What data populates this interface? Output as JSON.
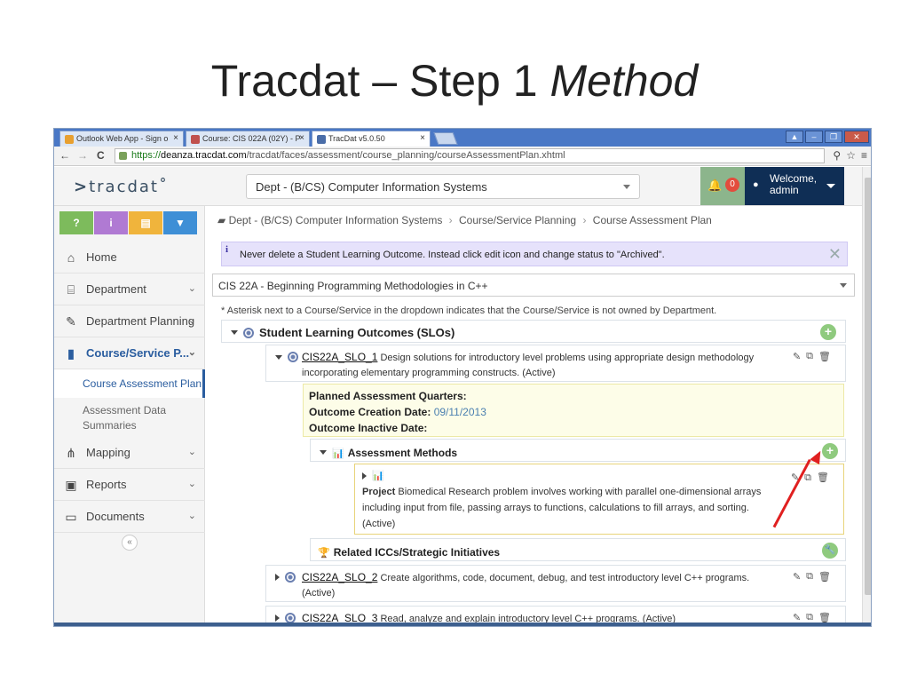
{
  "slide": {
    "title_plain": "Tracdat – Step 1 ",
    "title_italic": "Method"
  },
  "browser": {
    "tabs": [
      {
        "label": "Outlook Web App - Sign o",
        "color": "#e8a030"
      },
      {
        "label": "Course: CIS 022A (02Y) - P",
        "color": "#c0504d"
      },
      {
        "label": "TracDat v5.0.50",
        "color": "#4a6da8"
      }
    ],
    "window_buttons": [
      "▲",
      "–",
      "❐",
      "✕"
    ],
    "url_scheme": "https://",
    "url_host": "deanza.tracdat.com",
    "url_path": "/tracdat/faces/assessment/course_planning/courseAssessmentPlan.xhtml",
    "nav": {
      "back": "←",
      "forward": "→",
      "reload": "C"
    },
    "right_icons": [
      "⚲",
      "☆",
      "≡"
    ]
  },
  "header": {
    "logo": "tracdat",
    "logo_mark": ">",
    "logo_tm": "˚",
    "dept_select": "Dept - (B/CS) Computer Information Systems",
    "notifications": "0",
    "welcome_line1": "Welcome,",
    "welcome_line2": "admin",
    "bell_glyph": "🔔",
    "user_glyph": "●"
  },
  "quick_buttons": [
    {
      "label": "?",
      "color": "#7dbb5c"
    },
    {
      "label": "i",
      "color": "#b07ad3"
    },
    {
      "label": "▤",
      "color": "#f0b43c"
    },
    {
      "label": "▼",
      "color": "#3e8fd6"
    }
  ],
  "sidebar": {
    "items": [
      {
        "label": "Home",
        "icon": "⌂",
        "chev": ""
      },
      {
        "label": "Department",
        "icon": "⌸",
        "chev": "⌄"
      },
      {
        "label": "Department Planning",
        "icon": "✎",
        "chev": "⌄"
      },
      {
        "label": "Course/Service P...",
        "icon": "▮",
        "chev": "⌄"
      },
      {
        "label": "Mapping",
        "icon": "⋔",
        "chev": "⌄"
      },
      {
        "label": "Reports",
        "icon": "▣",
        "chev": "⌄"
      },
      {
        "label": "Documents",
        "icon": "▭",
        "chev": "⌄"
      }
    ],
    "subitems": [
      {
        "label": "Course Assessment Plan"
      },
      {
        "label": "Assessment Data Summaries"
      }
    ],
    "collapse": "«"
  },
  "main": {
    "breadcrumb": {
      "icon": "▰",
      "parts": [
        "Dept - (B/CS) Computer Information Systems",
        "Course/Service Planning",
        "Course Assessment Plan"
      ],
      "sep": "›"
    },
    "notice": {
      "icon": "i",
      "text": "Never delete a Student Learning Outcome. Instead click edit icon and change status to \"Archived\".",
      "close": "✕"
    },
    "course_select": "CIS 22A - Beginning Programming Methodologies in C++",
    "asterisk_note": "* Asterisk next to a Course/Service in the dropdown indicates that the Course/Service is not owned by Department.",
    "slos_header": "Student Learning Outcomes (SLOs)",
    "plus": "+",
    "actions": [
      "✎",
      "⧉",
      "🗑"
    ],
    "slo1": {
      "code": "CIS22A_SLO_1",
      "text": " Design solutions for introductory level problems using appropriate design methodology incorporating elementary programming constructs. (Active)"
    },
    "fields": {
      "planned_label": "Planned Assessment Quarters:",
      "creation_label": "Outcome Creation Date:",
      "creation_value": "09/11/2013",
      "inactive_label": "Outcome Inactive Date:"
    },
    "assessment_methods": "Assessment Methods",
    "methods_icon": "📊",
    "method": {
      "type": "Project",
      "text": " Biomedical Research problem involves working with parallel one-dimensional arrays including input from file, passing arrays to functions, calculations to fill arrays, and sorting. (Active)"
    },
    "related": "Related ICCs/Strategic Initiatives",
    "trophy": "🏆",
    "wrench": "🔧",
    "slo2": {
      "code": "CIS22A_SLO_2",
      "text": " Create algorithms, code, document, debug, and test introductory level C++ programs. (Active)"
    },
    "slo3": {
      "code": "CIS22A_SLO_3",
      "text": " Read, analyze and explain introductory level C++ programs. (Active)"
    }
  }
}
